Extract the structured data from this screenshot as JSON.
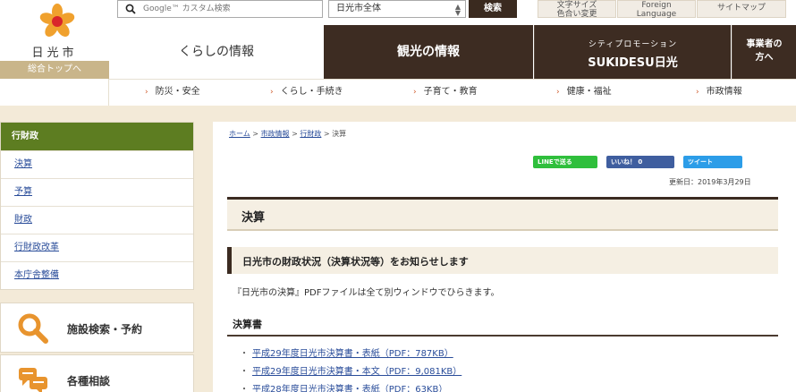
{
  "header": {
    "logo_text": "日光市",
    "home_link": "総合トップへ",
    "search": {
      "placeholder": "Google™ カスタム検索",
      "button": "検索"
    },
    "scope_select": {
      "selected": "日光市全体"
    },
    "util_links": [
      {
        "label": "文字サイズ\n色合い変更"
      },
      {
        "label": "Foreign\nLanguage"
      },
      {
        "label": "サイトマップ"
      }
    ],
    "nav": {
      "kurashi": "くらしの情報",
      "kanko": "観光の情報",
      "city_small": "シティプロモーション",
      "city_big": "SUKIDESU日光",
      "biz": "事業者の\n方へ"
    },
    "subnav": [
      "防災・安全",
      "くらし・手続き",
      "子育て・教育",
      "健康・福祉",
      "市政情報"
    ]
  },
  "sidebar": {
    "title": "行財政",
    "items": [
      "決算",
      "予算",
      "財政",
      "行財政改革",
      "本庁舎整備"
    ],
    "quick": [
      {
        "label": "施設検索・予約",
        "icon": "search-icon"
      },
      {
        "label": "各種相談",
        "icon": "speech-bubbles-icon"
      }
    ]
  },
  "main": {
    "breadcrumb": [
      "ホーム",
      "市政情報",
      "行財政",
      "決算"
    ],
    "breadcrumb_sep": " > ",
    "social": {
      "line": "LINEで送る",
      "facebook": "いいね！ 0",
      "twitter": "ツイート"
    },
    "updated": "更新日：2019年3月29日",
    "h1": "決算",
    "h2": "日光市の財政状況（決算状況等）をお知らせします",
    "intro": "『日光市の決算』PDFファイルは全て別ウィンドウでひらきます。",
    "h3": "決算書",
    "documents": [
      "平成29年度日光市決算書・表紙（PDF：787KB）",
      "平成29年度日光市決算書・本文（PDF：9,081KB）",
      "平成28年度日光市決算書・表紙（PDF：63KB）"
    ]
  },
  "colors": {
    "brand_dark": "#3d2c22",
    "sidebar_green": "#5d7d21",
    "link_blue": "#2a4d9a",
    "accent_orange": "#e8942e"
  }
}
